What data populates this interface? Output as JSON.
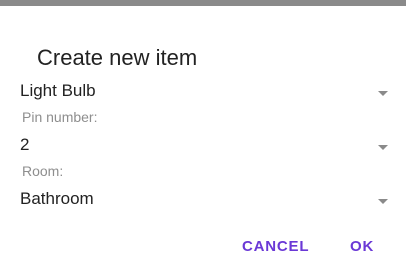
{
  "dialog": {
    "title": "Create new item",
    "type_select": {
      "value": "Light Bulb"
    },
    "pin_field": {
      "label": "Pin number:",
      "value": "2"
    },
    "room_field": {
      "label": "Room:",
      "value": "Bathroom"
    },
    "buttons": {
      "cancel_label": "CANCEL",
      "ok_label": "OK"
    }
  },
  "colors": {
    "accent": "#6a38d6",
    "label": "#8e8e8e",
    "text": "#222222",
    "topbar": "#8a8a8a"
  },
  "icons": [
    "dropdown-arrow-icon"
  ]
}
